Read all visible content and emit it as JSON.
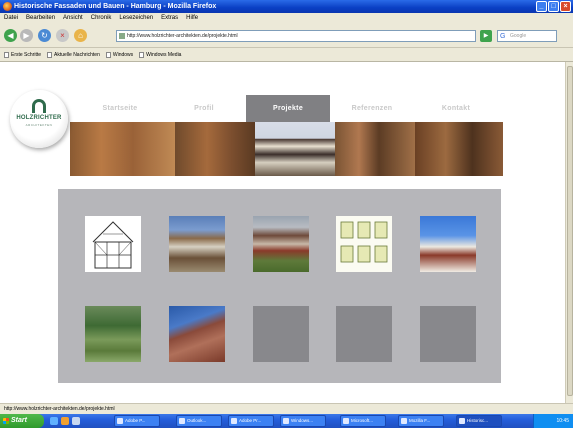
{
  "window": {
    "title": "Historische Fassaden und Bauen - Hamburg - Mozilla Firefox",
    "buttons": [
      "_",
      "□",
      "×"
    ]
  },
  "menubar": [
    "Datei",
    "Bearbeiten",
    "Ansicht",
    "Chronik",
    "Lesezeichen",
    "Extras",
    "Hilfe"
  ],
  "navbar": {
    "url": "http://www.holzrichter-architekten.de/projekte.html",
    "search_placeholder": "Google"
  },
  "bookmarks": [
    "Erste Schritte",
    "Aktuelle Nachrichten",
    "Windows",
    "Windows Media"
  ],
  "site": {
    "logo_name": "HOLZRICHTER",
    "logo_sub": "ARCHITEKTEN",
    "nav": [
      {
        "label": "Startseite",
        "active": false
      },
      {
        "label": "Profil",
        "active": false
      },
      {
        "label": "Projekte",
        "active": true
      },
      {
        "label": "Referenzen",
        "active": false
      },
      {
        "label": "Kontakt",
        "active": false
      }
    ]
  },
  "gallery": {
    "thumbnails": [
      "fachwerk-zeichnung",
      "fachwerkhaus-fassade",
      "fachwerkhaus-rot",
      "fenster-plan",
      "giebelhaus",
      "baum-garten",
      "backsteinbau",
      "leer",
      "leer",
      "leer"
    ]
  },
  "statusbar": "http://www.holzrichter-architekten.de/projekte.html",
  "taskbar": {
    "start_label": "Start",
    "tasks": [
      "Adobe P...",
      "Outlook...",
      "Adobe Pr...",
      "Windows...",
      "Microsoft...",
      "Mozilla F...",
      "Historisc..."
    ],
    "clock": "10:45"
  }
}
